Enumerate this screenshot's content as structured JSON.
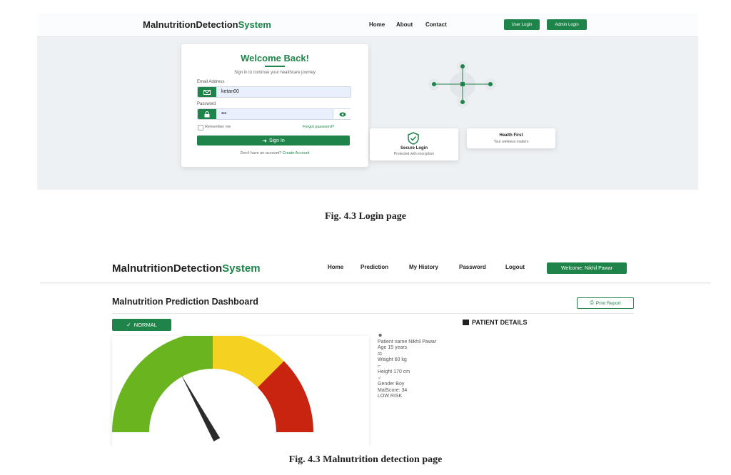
{
  "figure1": {
    "navbar": {
      "brand_prefix": "MalnutritionDetection",
      "brand_suffix": "System",
      "links": [
        "Home",
        "About",
        "Contact"
      ],
      "user_login": "User Login",
      "admin_login": "Admin Login"
    },
    "login_card": {
      "title": "Welcome Back!",
      "subtitle": "Sign in to continue your healthcare journey",
      "email_label": "Email Address",
      "email_value": "ketan00",
      "password_label": "Password",
      "password_value": "•••",
      "remember_label": "Remember me",
      "forgot_link": "Forgot password?",
      "sign_in": "Sign In",
      "no_account": "Don't have an account?",
      "create_account": "Create Account"
    },
    "feature_cards": [
      {
        "title": "Secure Login",
        "subtitle": "Protected with encryption"
      },
      {
        "title": "Health First",
        "subtitle": "Your wellness matters"
      }
    ],
    "caption": "Fig. 4.3 Login page"
  },
  "figure2": {
    "navbar": {
      "brand_prefix": "MalnutritionDetection",
      "brand_suffix": "System",
      "links": [
        "Home",
        "Prediction",
        "My History",
        "Password",
        "Logout"
      ],
      "welcome": "Welcome, Nikhil Pawar"
    },
    "dashboard_title": "Malnutrition Prediction Dashboard",
    "print_report": "Print Report",
    "status_badge": "NORMAL",
    "patient_details_title": "PATIENT DETAILS",
    "patient": {
      "name": "Patient name Nikhil Pawar",
      "age": "Age 15 years",
      "weight": "Weight 60 kg",
      "height": "Height 170 cm",
      "gender": "Gender Boy",
      "malscore": "MalScore: 34",
      "risk": "LOW RISK"
    },
    "gauge": {
      "value": 34,
      "min": 0,
      "max": 100,
      "colors": [
        "#6ab51f",
        "#f5d21f",
        "#c8240f"
      ]
    },
    "caption": "Fig. 4.3 Malnutrition detection page"
  },
  "colors": {
    "accent": "#1e8449"
  }
}
